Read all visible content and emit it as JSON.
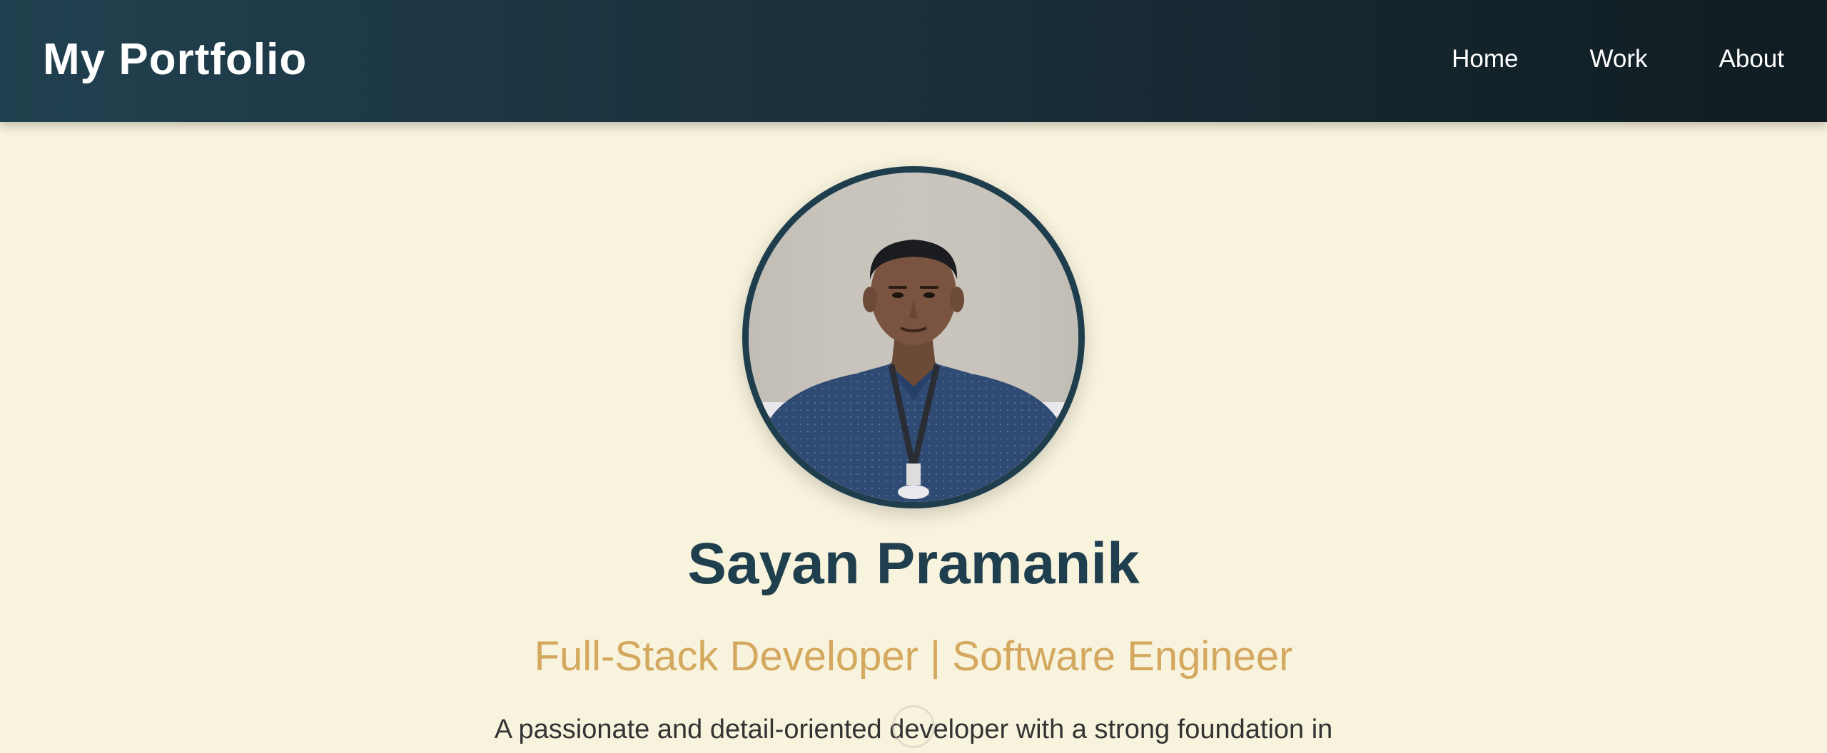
{
  "header": {
    "brand": "My Portfolio",
    "nav": [
      {
        "label": "Home"
      },
      {
        "label": "Work"
      },
      {
        "label": "About"
      }
    ]
  },
  "hero": {
    "name": "Sayan Pramanik",
    "tagline": "Full-Stack Developer | Software Engineer",
    "intro": "A passionate and detail-oriented developer with a strong foundation in"
  },
  "colors": {
    "nav_bg_start": "#21404f",
    "nav_bg_end": "#101c21",
    "page_bg": "#f8f3dd",
    "name": "#1f3f4e",
    "tagline": "#d4a85e",
    "avatar_border": "#1e3e4d"
  }
}
